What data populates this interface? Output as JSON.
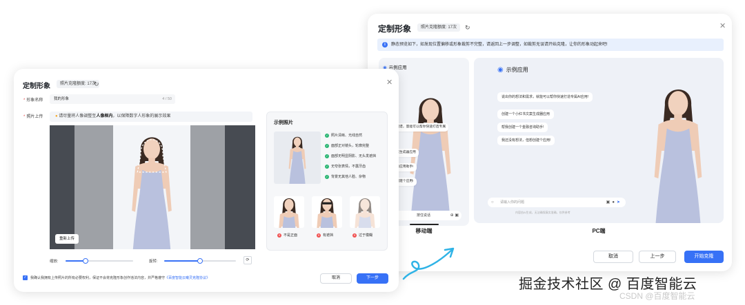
{
  "right_dialog": {
    "title": "定制形象",
    "quota_badge": "照片克隆额度: 17次",
    "refresh_icon": "refresh-icon",
    "close_icon": "close-icon",
    "notice": "静态预览如下，如发现位置偏移或形象裁剪不完整，请返回上一步调整，如裁剪无误请开始克隆，让你的形象动起来吧!",
    "mobile_preview": {
      "header": "示例应用",
      "bubbles": [
        "想进知识图谱，量能可以帮你快速打造专属",
        "小红书文案生成器应用",
        "一个全新的应用助手!",
        "法，但是创建个应用!"
      ],
      "input_placeholder": "按住说话",
      "caption": "移动端"
    },
    "pc_preview": {
      "header": "示例应用",
      "bubbles": [
        "说出你的想法和需求，就能可以帮你快速打造专属AI应用!",
        "创建一个小红书文案生成器应用",
        "帮我创建一个金融咨询助手!",
        "我还没有想法，但想创建个应用!"
      ],
      "input_placeholder": "请输入你的问题",
      "footer": "内容由AI生成，无法确保真实准确，仅供参考",
      "caption": "PC端"
    },
    "buttons": {
      "cancel": "取消",
      "prev": "上一步",
      "start": "开始克隆"
    }
  },
  "left_dialog": {
    "title": "定制形象",
    "quota_badge": "照片克隆额度: 17次",
    "name_label": "形象名称",
    "name_value": "我的形象",
    "name_count": "4 / 50",
    "photo_label": "照片上传",
    "tip_prefix": "请尽量将人像调整至",
    "tip_emphasis": "人像框内",
    "tip_suffix": "，以保障数字人形象的展示效果",
    "reupload": "重新上传",
    "zoom_label": "缩放:",
    "zoom_value": 0.3,
    "rotate_label": "旋转:",
    "rotate_value": 0.5,
    "agree_text": "我确认我拥有上传照片的所有必要权利，保证不会将克隆形象创作违法内容，并严格遵守",
    "agree_link": "《百度智能云曦灵克隆协议》",
    "example": {
      "title": "示例照片",
      "rules": [
        "照片清晰、光线自然",
        "面部正对镜头，轮廓完整",
        "面部无明显阴影、无头发遮挡",
        "无夸张表情，不露牙齿",
        "背景无其他人脸、杂物"
      ],
      "bad_labels": [
        "不是正面",
        "有遮挡",
        "过于模糊"
      ]
    },
    "buttons": {
      "cancel": "取消",
      "next": "下一步"
    }
  },
  "watermark": "掘金技术社区 @ 百度智能云",
  "watermark_csdn": "CSDN @百度智能云",
  "colors": {
    "primary": "#3771f6",
    "success": "#2bb673",
    "danger": "#f05050"
  }
}
